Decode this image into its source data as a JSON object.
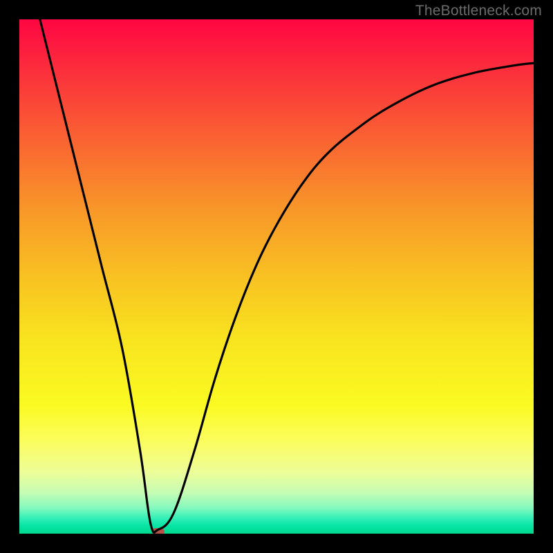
{
  "watermark": "TheBottleneck.com",
  "chart_data": {
    "type": "line",
    "title": "",
    "xlabel": "",
    "ylabel": "",
    "xlim": [
      0,
      100
    ],
    "ylim": [
      0,
      100
    ],
    "grid": false,
    "legend": false,
    "background_gradient": {
      "top": "#fe0643",
      "bottom": "#00d98e"
    },
    "series": [
      {
        "name": "bottleneck-curve",
        "color": "#000000",
        "x": [
          4,
          8,
          12,
          16,
          20,
          23.5,
          25.5,
          27,
          30,
          34,
          38,
          42,
          46,
          50,
          55,
          60,
          66,
          72,
          80,
          88,
          96,
          100
        ],
        "y": [
          100,
          84,
          68,
          52,
          36,
          16,
          2,
          0.8,
          4,
          16,
          30,
          42,
          52,
          60,
          68,
          74,
          79,
          83,
          87,
          89.5,
          91,
          91.5
        ]
      }
    ],
    "marker": {
      "name": "minimum-marker",
      "x": 27,
      "y": 0.4,
      "color": "#b85249"
    }
  }
}
